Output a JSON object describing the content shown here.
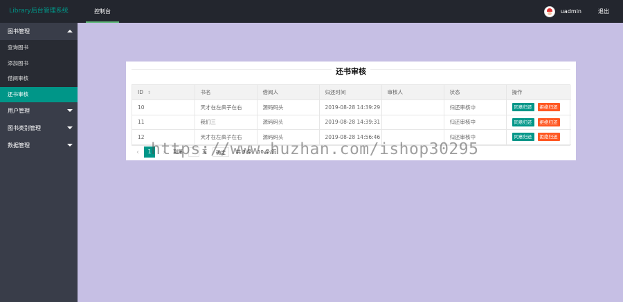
{
  "header": {
    "logo": "Library后台管理系统",
    "nav": [
      {
        "label": "控制台",
        "active": true
      }
    ],
    "user": {
      "name": "uadmin",
      "logout": "退出"
    }
  },
  "sidebar": {
    "groups": [
      {
        "label": "图书管理",
        "expanded": true,
        "items": [
          {
            "label": "查询图书",
            "active": false
          },
          {
            "label": "添加图书",
            "active": false
          },
          {
            "label": "借阅审核",
            "active": false
          },
          {
            "label": "还书审核",
            "active": true
          }
        ]
      },
      {
        "label": "用户管理",
        "expanded": false
      },
      {
        "label": "图书类别管理",
        "expanded": false
      },
      {
        "label": "数据管理",
        "expanded": false
      }
    ]
  },
  "panel": {
    "title": "还书审核",
    "columns": [
      "ID",
      "书名",
      "借阅人",
      "归还时间",
      "审核人",
      "状态",
      "操作"
    ],
    "rows": [
      {
        "id": "10",
        "book": "天才在左疯子在右",
        "borrower": "源码码头",
        "return_time": "2019-08-28 14:39:29",
        "reviewer": "",
        "status": "归还审核中"
      },
      {
        "id": "11",
        "book": "我们三",
        "borrower": "源码码头",
        "return_time": "2019-08-28 14:39:31",
        "reviewer": "",
        "status": "归还审核中"
      },
      {
        "id": "12",
        "book": "天才在左疯子在右",
        "borrower": "源码码头",
        "return_time": "2019-08-28 14:56:46",
        "reviewer": "",
        "status": "归还审核中"
      }
    ],
    "actions": {
      "approve": "同意归还",
      "reject": "拒绝归还"
    }
  },
  "pager": {
    "prev": "‹",
    "current": "1",
    "next": "›",
    "goto_label": "到第",
    "page_unit": "页",
    "confirm": "确定",
    "total": "共 3 条",
    "page_size": "10 条/页"
  },
  "watermark": "https://www.huzhan.com/ishop30295",
  "colors": {
    "accent": "#009688",
    "danger": "#ff5722",
    "header_bg": "#23262e",
    "sidebar_bg": "#393d49",
    "page_bg": "#c6bfe4"
  }
}
